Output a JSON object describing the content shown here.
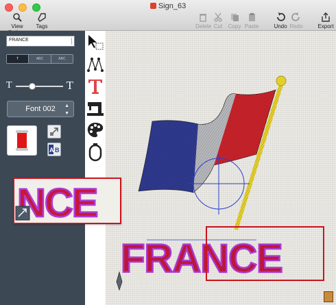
{
  "window": {
    "title": "Sign_63"
  },
  "toolbar": {
    "view_options": "View Options",
    "tags": "Tags",
    "delete": "Delete",
    "cut": "Cut",
    "copy": "Copy",
    "paste": "Paste",
    "undo": "Undo",
    "redo": "Redo",
    "export": "Export"
  },
  "panel": {
    "text_value": "FRANCE",
    "font_name": "Font 002",
    "size_slider_level": 0.35,
    "size_small_glyph": "T",
    "size_large_glyph": "T",
    "text_modes": [
      "T",
      "ABC",
      "ABC"
    ],
    "thread_color": "#e01515"
  },
  "canvas": {
    "embroidered_text": "FRANCE",
    "zoom_text": "NCE",
    "flag_colors": [
      "#2f3a8f",
      "#b7b8bc",
      "#c9232a"
    ],
    "pole_color": "#e3cf2e",
    "text_fill": "#c4183d",
    "text_outline": "#b03bd6",
    "selection_color": "#c8141f"
  }
}
